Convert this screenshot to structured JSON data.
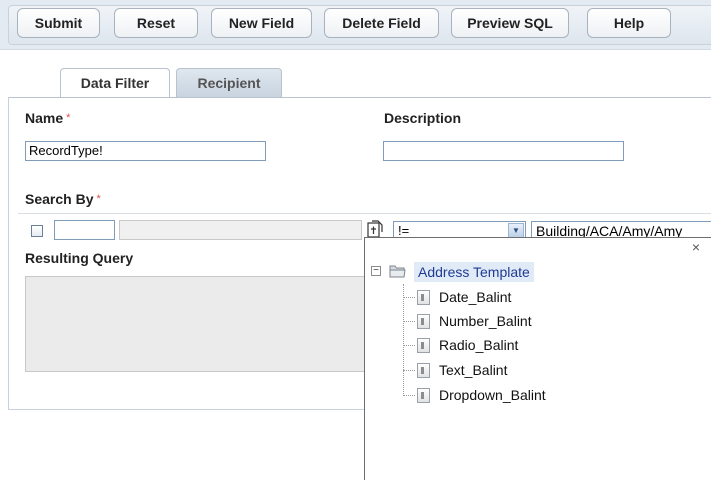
{
  "toolbar": {
    "buttons": [
      "Submit",
      "Reset",
      "New Field",
      "Delete Field",
      "Preview SQL",
      "Help"
    ]
  },
  "tabs": [
    {
      "label": "Data Filter",
      "active": true
    },
    {
      "label": "Recipient",
      "active": false
    }
  ],
  "form": {
    "name_label": "Name",
    "name_value": "RecordType!",
    "description_label": "Description",
    "description_value": "",
    "required_marker": "*",
    "search_by_label": "Search By",
    "search_checked": false,
    "search_field1_value": "",
    "search_field2_value": "",
    "operator_value": "!=",
    "search_value": "Building/ACA/Amy/Amy",
    "resulting_query_label": "Resulting Query",
    "resulting_query_value": ""
  },
  "popup": {
    "close_glyph": "×",
    "root_label": "Address Template",
    "expander": "−",
    "items": [
      "Date_Balint",
      "Number_Balint",
      "Radio_Balint",
      "Text_Balint",
      "Dropdown_Balint"
    ]
  },
  "colors": {
    "toolbar_bg": "#e4eaf1",
    "tree_root_highlight": "#e1ebf7",
    "required": "#d9534f"
  }
}
